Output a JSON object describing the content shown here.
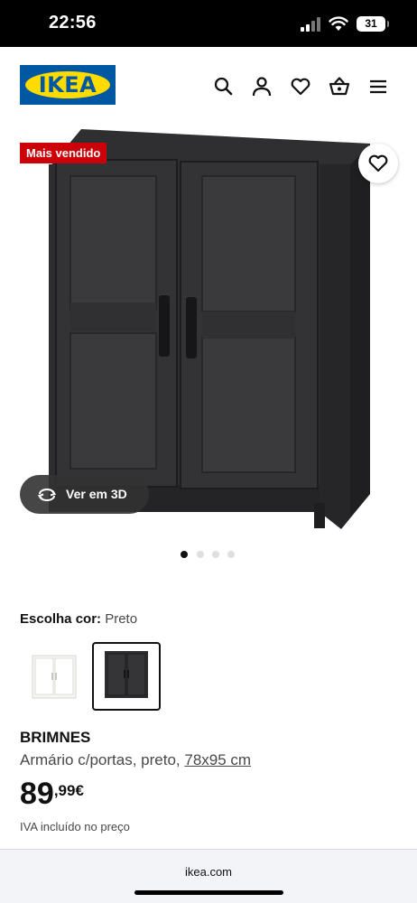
{
  "status": {
    "time": "22:56",
    "battery": "31"
  },
  "header": {
    "logo_text": "IKEA",
    "icons": [
      "search-icon",
      "user-icon",
      "heart-icon",
      "shopping-bag-icon",
      "menu-icon"
    ]
  },
  "product": {
    "badge": "Mais vendido",
    "view3d_label": "Ver em 3D",
    "carousel": {
      "total": 4,
      "active_index": 0
    },
    "color_label": "Escolha cor:",
    "color_value": "Preto",
    "swatches": [
      "white",
      "black"
    ],
    "selected_swatch": 1,
    "name": "BRIMNES",
    "description": "Armário c/portas, preto,",
    "dimensions": "78x95 cm",
    "price_int": "89",
    "price_dec": ",99€",
    "vat_note": "IVA incluído no preço"
  },
  "browser": {
    "url": "ikea.com"
  },
  "colors": {
    "brand_blue": "#0058A3",
    "brand_yellow": "#FFDB00",
    "badge_red": "#CC0008"
  }
}
